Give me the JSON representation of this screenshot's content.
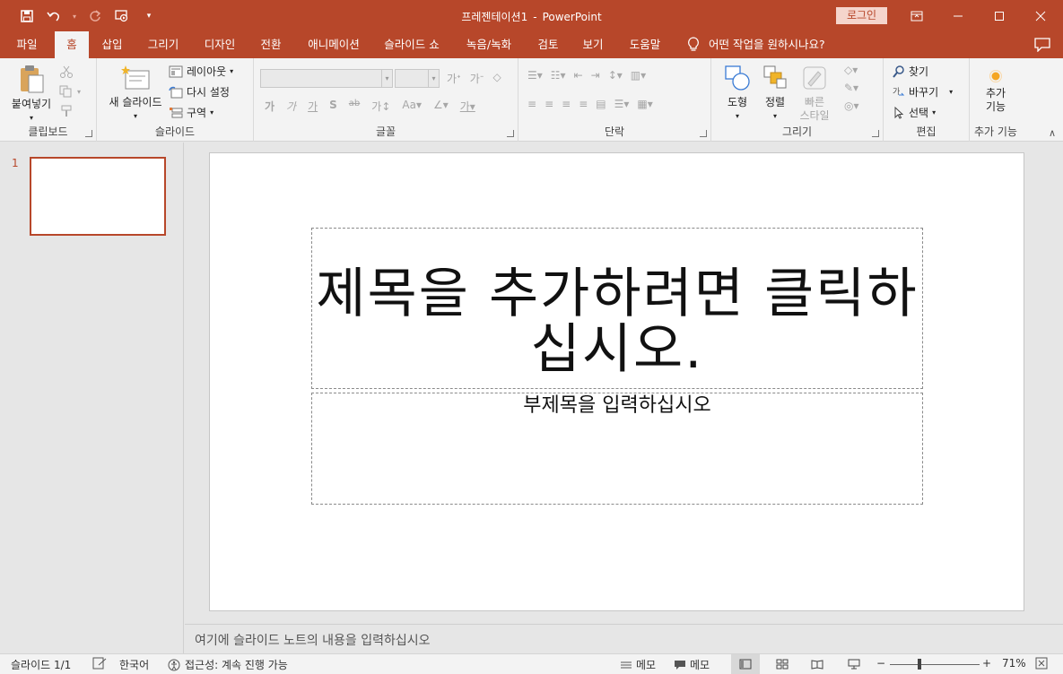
{
  "window": {
    "doc_name": "프레젠테이션1",
    "separator": "-",
    "app_name": "PowerPoint",
    "login_label": "로그인"
  },
  "qat": {
    "save": "save-icon",
    "undo": "undo-icon",
    "redo": "redo-icon",
    "present": "present-icon",
    "customize": "customize-icon"
  },
  "tabs": [
    "파일",
    "홈",
    "삽입",
    "그리기",
    "디자인",
    "전환",
    "애니메이션",
    "슬라이드 쇼",
    "녹음/녹화",
    "검토",
    "보기",
    "도움말"
  ],
  "active_tab": "홈",
  "tell_me": "어떤 작업을 원하시나요?",
  "ribbon": {
    "clipboard": {
      "label": "클립보드",
      "paste": "붙여넣기"
    },
    "slides": {
      "label": "슬라이드",
      "new_slide": "새 슬라이드",
      "layout": "레이아웃",
      "reset": "다시 설정",
      "section": "구역"
    },
    "font": {
      "label": "글꼴"
    },
    "paragraph": {
      "label": "단락"
    },
    "drawing": {
      "label": "그리기",
      "shapes": "도형",
      "arrange": "정렬",
      "quick_styles_1": "빠른",
      "quick_styles_2": "스타일"
    },
    "editing": {
      "label": "편집",
      "find": "찾기",
      "replace": "바꾸기",
      "select": "선택"
    },
    "addins": {
      "label": "추가 기능",
      "btn_1": "추가",
      "btn_2": "기능"
    }
  },
  "thumbnails": {
    "number": "1"
  },
  "slide": {
    "title_line1": "제목을 추가하려면 클릭하",
    "title_line2": "십시오.",
    "subtitle": "부제목을 입력하십시오"
  },
  "notes_placeholder": "여기에 슬라이드 노트의 내용을 입력하십시오",
  "status": {
    "slide_count": "슬라이드 1/1",
    "language": "한국어",
    "accessibility": "접근성: 계속 진행 가능",
    "notes": "메모",
    "comments": "메모",
    "zoom_minus": "−",
    "zoom_plus": "+",
    "zoom_percent": "71%"
  },
  "colors": {
    "accent": "#b7472a"
  }
}
